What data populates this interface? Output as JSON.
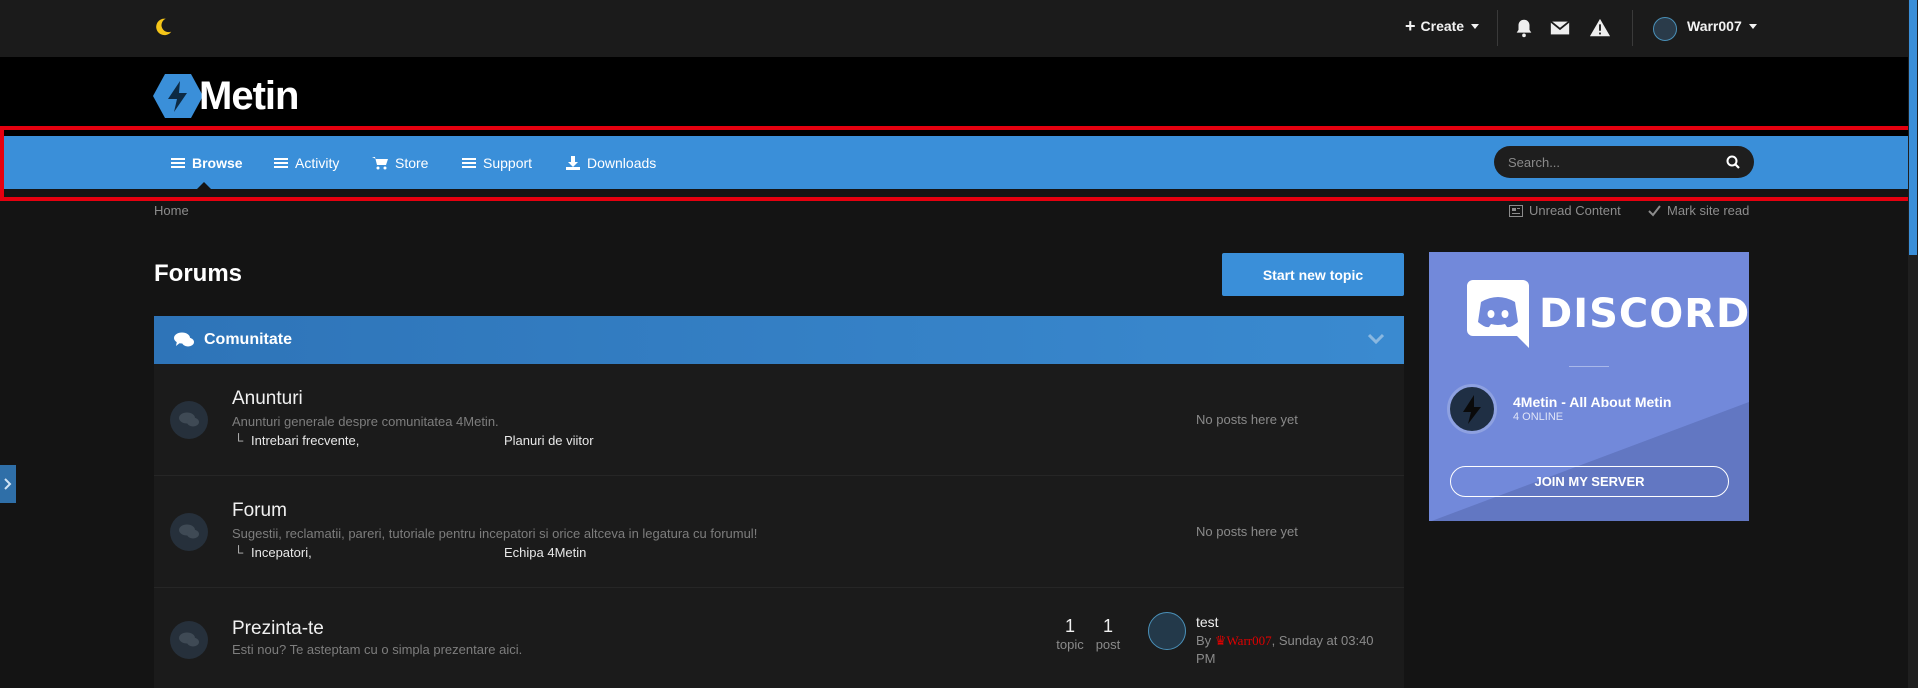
{
  "userbar": {
    "theme_icon": "moon-icon",
    "create_label": "Create",
    "username": "Warr007",
    "icons": [
      "bell-icon",
      "envelope-icon",
      "warning-icon"
    ]
  },
  "brand": {
    "logo_text": "Metin",
    "logo_icon": "4metin-logo-icon"
  },
  "nav": {
    "items": [
      {
        "label": "Browse",
        "icon": "menu-icon"
      },
      {
        "label": "Activity",
        "icon": "menu-icon"
      },
      {
        "label": "Store",
        "icon": "cart-icon"
      },
      {
        "label": "Support",
        "icon": "menu-icon"
      },
      {
        "label": "Downloads",
        "icon": "download-icon"
      }
    ],
    "search_placeholder": "Search..."
  },
  "breadcrumb": {
    "home": "Home",
    "unread": "Unread Content",
    "mark_read": "Mark site read"
  },
  "main": {
    "title": "Forums",
    "start_topic": "Start new topic",
    "category": {
      "title": "Comunitate",
      "forums": [
        {
          "title": "Anunturi",
          "desc": "Anunturi generale despre comunitatea 4Metin.",
          "sub1": "Intrebari frecvente,",
          "sub2": "Planuri de viitor",
          "status": "No posts here yet"
        },
        {
          "title": "Forum",
          "desc": "Sugestii, reclamatii, pareri, tutoriale pentru incepatori si orice altceva in legatura cu forumul!",
          "sub1": "Incepatori,",
          "sub2": "Echipa 4Metin",
          "status": "No posts here yet"
        },
        {
          "title": "Prezinta-te",
          "desc": "Esti nou? Te asteptam cu o simpla prezentare aici.",
          "topics_count": "1",
          "topics_label": "topic",
          "posts_count": "1",
          "posts_label": "post",
          "last_title": "test",
          "last_by": "By",
          "last_user": "Warr007",
          "last_when": ", Sunday at 03:40 PM"
        }
      ]
    }
  },
  "discord": {
    "wordmark": "DISCORD",
    "server_name": "4Metin - All About Metin",
    "online": "4 ONLINE",
    "join": "JOIN MY SERVER"
  },
  "colors": {
    "accent": "#3a8fd9",
    "highlight": "#e5000f",
    "discord": "#7289da",
    "background": "#141414"
  }
}
